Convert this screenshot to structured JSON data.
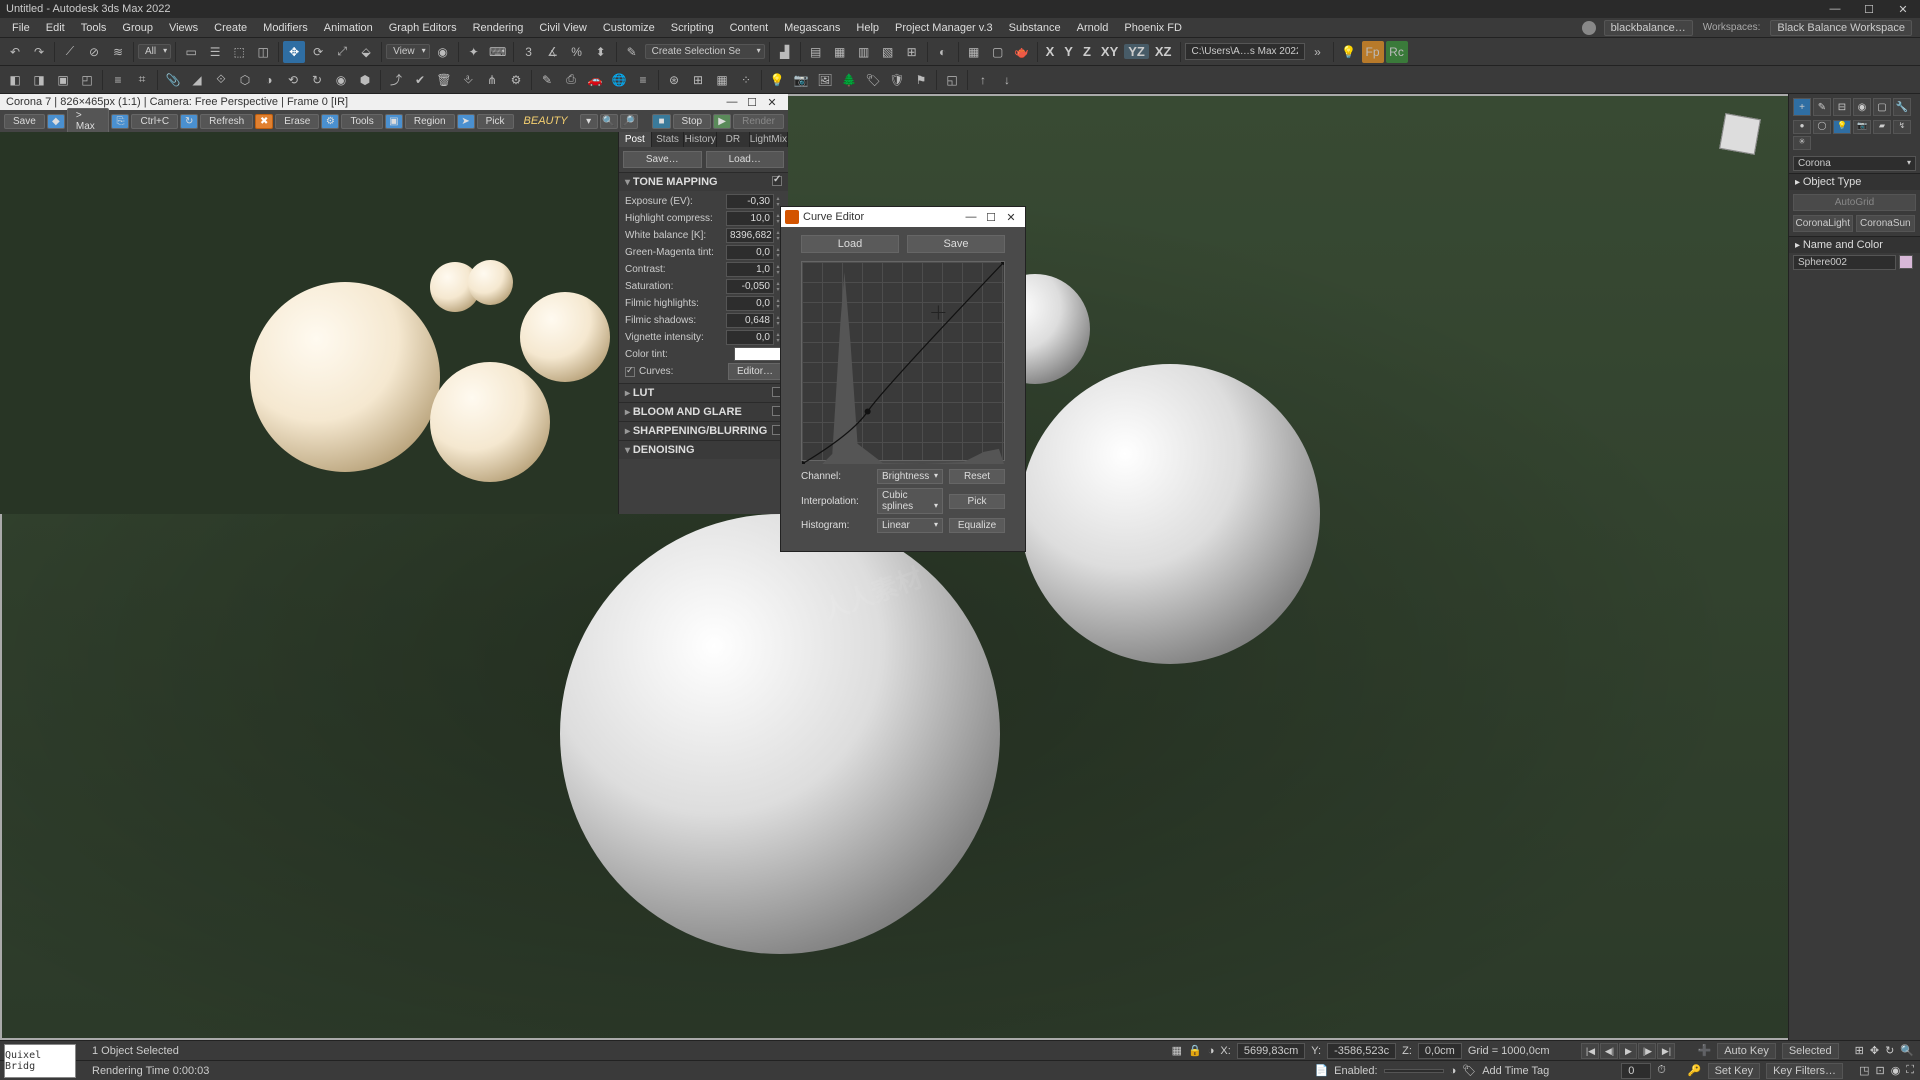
{
  "window": {
    "title": "Untitled - Autodesk 3ds Max 2022"
  },
  "account": {
    "name": "blackbalance…"
  },
  "workspace": {
    "label": "Workspaces:",
    "name": "Black Balance Workspace"
  },
  "menu": [
    "File",
    "Edit",
    "Tools",
    "Group",
    "Views",
    "Create",
    "Modifiers",
    "Animation",
    "Graph Editors",
    "Rendering",
    "Civil View",
    "Customize",
    "Scripting",
    "Content",
    "Megascans",
    "Help",
    "Project Manager v.3",
    "Substance",
    "Arnold",
    "Phoenix FD"
  ],
  "toolbar1": {
    "all": "All",
    "view": "View",
    "selset": "Create Selection Se",
    "axes": [
      "X",
      "Y",
      "Z",
      "XY",
      "YZ",
      "XZ"
    ],
    "path": "C:\\Users\\A…s Max 2022"
  },
  "vfb": {
    "title": "Corona 7 | 826×465px (1:1) | Camera: Free Perspective | Frame 0 [IR]",
    "btns": {
      "save": "Save",
      "tomax": "> Max",
      "ctrlc": "Ctrl+C",
      "refresh": "Refresh",
      "erase": "Erase",
      "tools": "Tools",
      "region": "Region",
      "pick": "Pick"
    },
    "renderpass": "BEAUTY",
    "stop": "Stop",
    "render": "Render",
    "tabs": [
      "Post",
      "Stats",
      "History",
      "DR",
      "LightMix"
    ],
    "save2": "Save…",
    "load2": "Load…",
    "sections": {
      "tone": "TONE MAPPING",
      "lut": "LUT",
      "bloom": "BLOOM AND GLARE",
      "sharp": "SHARPENING/BLURRING",
      "denoise": "DENOISING"
    },
    "tone": {
      "exposure_lbl": "Exposure (EV):",
      "exposure": "-0,30",
      "highlight_lbl": "Highlight compress:",
      "highlight": "10,0",
      "wb_lbl": "White balance [K]:",
      "wb": "8396,682",
      "gm_lbl": "Green-Magenta tint:",
      "gm": "0,0",
      "contrast_lbl": "Contrast:",
      "contrast": "1,0",
      "sat_lbl": "Saturation:",
      "sat": "-0,050",
      "fh_lbl": "Filmic highlights:",
      "fh": "0,0",
      "fs_lbl": "Filmic shadows:",
      "fs": "0,648",
      "vig_lbl": "Vignette intensity:",
      "vig": "0,0",
      "tint_lbl": "Color tint:",
      "curves_lbl": "Curves:",
      "editor": "Editor…"
    }
  },
  "curve": {
    "title": "Curve Editor",
    "load": "Load",
    "save": "Save",
    "channel_lbl": "Channel:",
    "channel": "Brightness",
    "interp_lbl": "Interpolation:",
    "interp": "Cubic splines",
    "hist_lbl": "Histogram:",
    "hist": "Linear",
    "reset": "Reset",
    "pick": "Pick",
    "equalize": "Equalize"
  },
  "right": {
    "category": "Corona",
    "objtype": "Object Type",
    "autogrid": "AutoGrid",
    "light": "CoronaLight",
    "sun": "CoronaSun",
    "namecolor": "Name and Color",
    "objname": "Sphere002"
  },
  "status": {
    "selected": "1 Object Selected",
    "rendertime": "Rendering Time 0:00:03",
    "enabled": "Enabled:",
    "x_lbl": "X:",
    "x": "5699,83cm",
    "y_lbl": "Y:",
    "y": "-3586,523c",
    "z_lbl": "Z:",
    "z": "0,0cm",
    "grid": "Grid = 1000,0cm",
    "addtag": "Add Time Tag",
    "autokey": "Auto Key",
    "selected2": "Selected",
    "setkey": "Set Key",
    "keyfilters": "Key Filters…",
    "quixel": "Quixel Bridg"
  }
}
